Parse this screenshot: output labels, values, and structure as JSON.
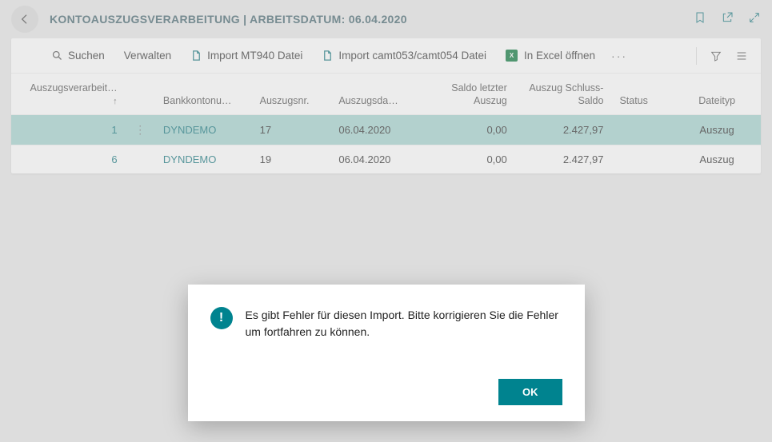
{
  "header": {
    "title": "KONTOAUSZUGSVERARBEITUNG | ARBEITSDATUM: 06.04.2020"
  },
  "toolbar": {
    "search": "Suchen",
    "manage": "Verwalten",
    "import_mt940": "Import MT940 Datei",
    "import_camt": "Import camt053/camt054 Datei",
    "open_excel": "In Excel öffnen"
  },
  "columns": {
    "proc": "Auszugsverarbeit…",
    "bank": "Bankkontonu…",
    "stmt_no": "Auszugsnr.",
    "stmt_date": "Auszugsda…",
    "prev_balance": "Saldo letzter Auszug",
    "closing_balance": "Auszug Schluss-Saldo",
    "status": "Status",
    "file_type": "Dateityp"
  },
  "rows": [
    {
      "proc": "1",
      "bank": "DYNDEMO",
      "stmt_no": "17",
      "stmt_date": "06.04.2020",
      "prev_balance": "0,00",
      "closing_balance": "2.427,97",
      "status": "",
      "file_type": "Auszug",
      "selected": true
    },
    {
      "proc": "6",
      "bank": "DYNDEMO",
      "stmt_no": "19",
      "stmt_date": "06.04.2020",
      "prev_balance": "0,00",
      "closing_balance": "2.427,97",
      "status": "",
      "file_type": "Auszug",
      "selected": false
    }
  ],
  "dialog": {
    "message": "Es gibt Fehler für diesen Import. Bitte korrigieren Sie die Fehler um fortfahren zu können.",
    "ok": "OK"
  }
}
